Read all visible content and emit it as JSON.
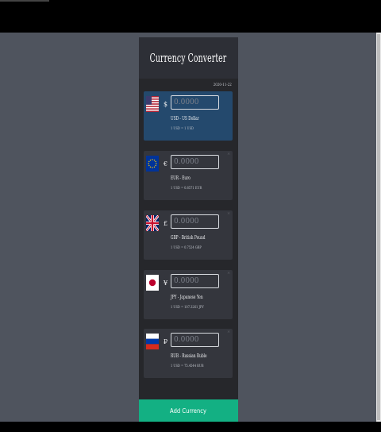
{
  "app": {
    "title": "Currency Converter",
    "date": "2020-11-22",
    "add_button_label": "Add Currency"
  },
  "colors": {
    "page_bg": "#4f545e",
    "app_bg": "#26272b",
    "header_bg": "#2d2f36",
    "card_bg": "#34363d",
    "card_active_bg": "#24496d",
    "accent_green": "#13b083"
  },
  "currencies": [
    {
      "code": "USD",
      "symbol": "$",
      "name": "USD - US Dollar",
      "rate": "1 USD = 1 USD",
      "placeholder": "0.0000",
      "flag": "us-flag-icon",
      "active": true
    },
    {
      "code": "EUR",
      "symbol": "€",
      "name": "EUR - Euro",
      "rate": "1 USD = 0.8571 EUR",
      "placeholder": "0.0000",
      "flag": "eu-flag-icon",
      "active": false
    },
    {
      "code": "GBP",
      "symbol": "£",
      "name": "GBP - British Pound",
      "rate": "1 USD = 0.7524 GBP",
      "placeholder": "0.0000",
      "flag": "uk-flag-icon",
      "active": false
    },
    {
      "code": "JPY",
      "symbol": "¥",
      "name": "JPY - Japanese Yen",
      "rate": "1 USD = 107.3261 JPY",
      "placeholder": "0.0000",
      "flag": "japan-flag-icon",
      "active": false
    },
    {
      "code": "RUB",
      "symbol": "₽",
      "name": "RUB - Russian Ruble",
      "rate": "1 USD = 75.4544 RUB",
      "placeholder": "0.0000",
      "flag": "russia-flag-icon",
      "active": false
    }
  ]
}
